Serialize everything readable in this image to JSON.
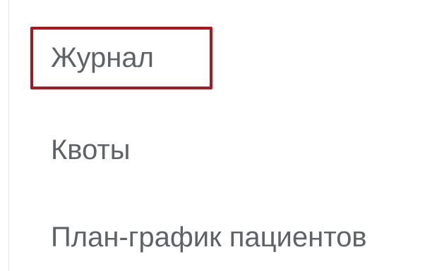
{
  "menu": {
    "items": [
      {
        "label": "Журнал",
        "highlighted": true
      },
      {
        "label": "Квоты",
        "highlighted": false
      },
      {
        "label": "План-график пациентов",
        "highlighted": false
      }
    ]
  },
  "colors": {
    "text": "#5f6368",
    "highlight_border": "#b5121b",
    "divider": "#e4e6ea",
    "background": "#ffffff"
  }
}
